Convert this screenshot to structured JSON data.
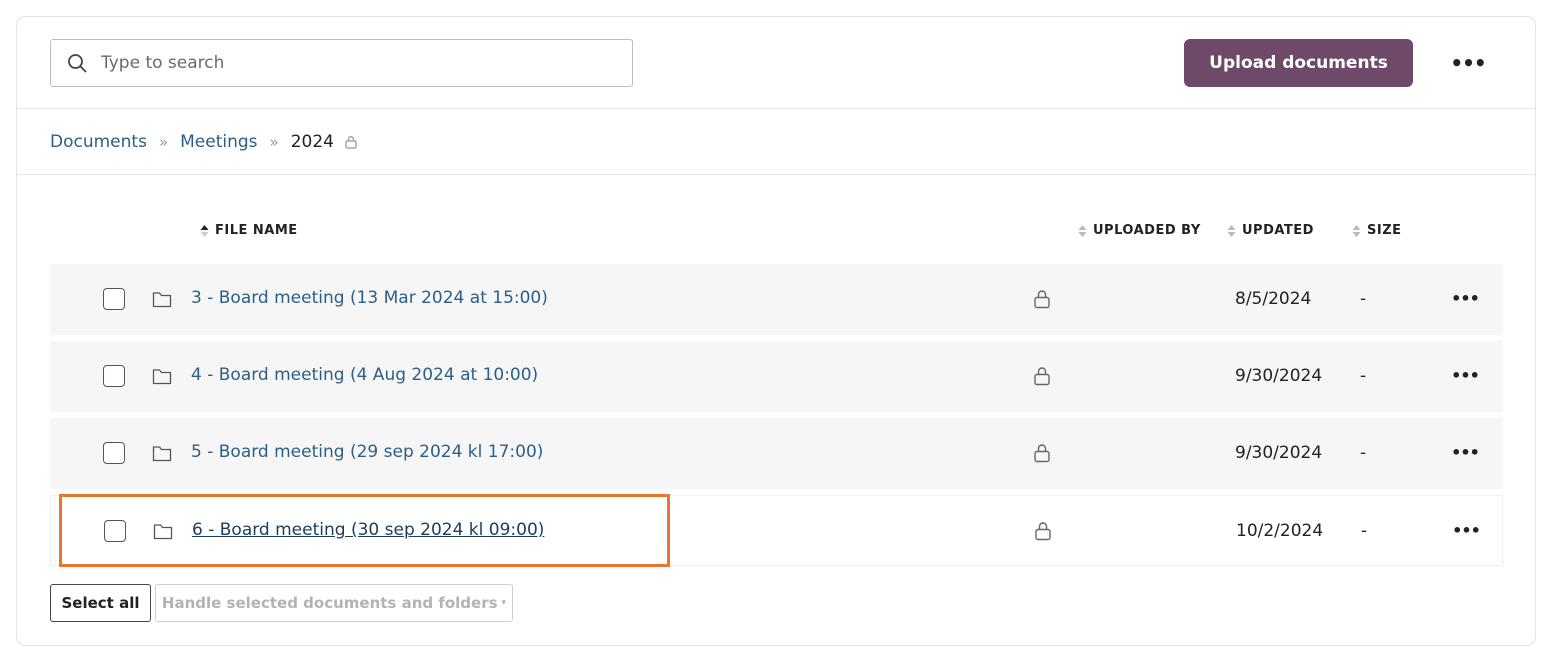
{
  "search": {
    "placeholder": "Type to search"
  },
  "toolbar": {
    "upload_label": "Upload documents",
    "more_label": "•••"
  },
  "breadcrumb": {
    "items": [
      "Documents",
      "Meetings"
    ],
    "current": "2024",
    "separator": "»"
  },
  "table": {
    "headers": {
      "file_name": "FILE NAME",
      "uploaded_by": "UPLOADED BY",
      "updated": "UPDATED",
      "size": "SIZE"
    },
    "rows": [
      {
        "name": "3 - Board meeting (13 Mar 2024 at 15:00)",
        "updated": "8/5/2024",
        "size": "-",
        "more": "•••"
      },
      {
        "name": "4 - Board meeting (4 Aug 2024 at 10:00)",
        "updated": "9/30/2024",
        "size": "-",
        "more": "•••"
      },
      {
        "name": "5 - Board meeting (29 sep 2024 kl 17:00)",
        "updated": "9/30/2024",
        "size": "-",
        "more": "•••"
      },
      {
        "name": "6 - Board meeting (30 sep 2024 kl 09:00)",
        "updated": "10/2/2024",
        "size": "-",
        "more": "•••"
      }
    ]
  },
  "footer": {
    "select_all": "Select all",
    "handle_selected": "Handle selected documents and folders",
    "caret": "▾"
  },
  "colors": {
    "accent": "#6e4a68",
    "link": "#2c5f86",
    "highlight": "#e8772e",
    "row_bg": "#f6f6f6"
  },
  "icons": [
    "search-icon",
    "lock-icon",
    "folder-icon",
    "sort-icon",
    "more-icon"
  ]
}
